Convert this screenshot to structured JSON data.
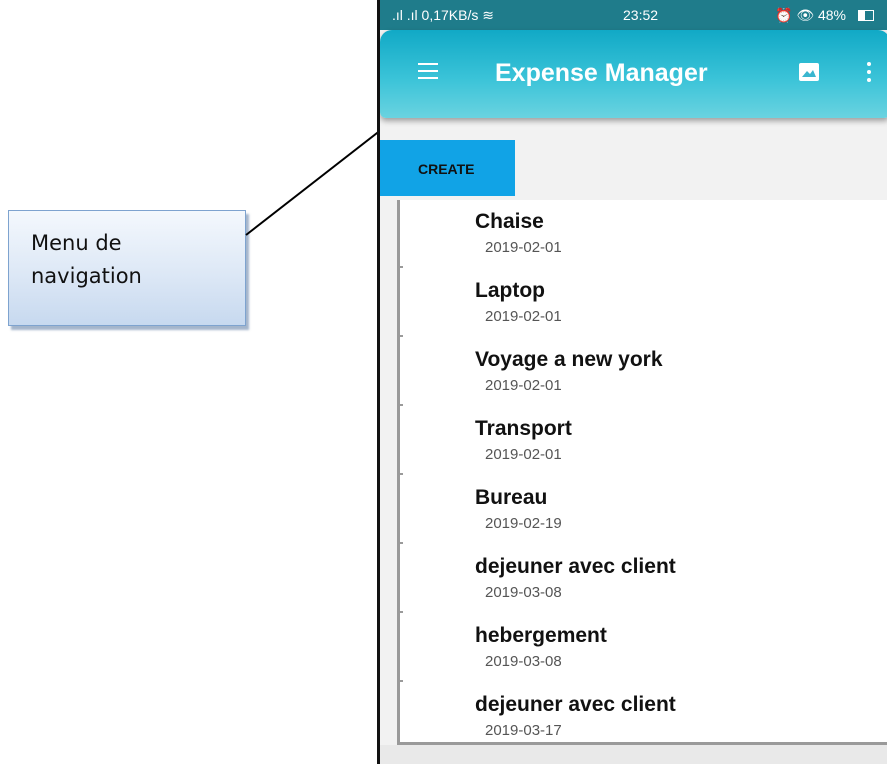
{
  "annotation": {
    "line1": "Menu de",
    "line2": "navigation"
  },
  "status_bar": {
    "left": ".ıl .ıl 0,17KB/s ≋",
    "time": "23:52",
    "right": "⏰ 👁 48%"
  },
  "app_bar": {
    "title": "Expense Manager",
    "menu_icon": "hamburger-menu-icon",
    "image_icon": "image-icon",
    "more_icon": "more-vert-icon"
  },
  "tabs": {
    "create_label": "CREATE"
  },
  "expenses": [
    {
      "name": "Chaise",
      "date": "2019-02-01"
    },
    {
      "name": "Laptop",
      "date": "2019-02-01"
    },
    {
      "name": "Voyage a new york",
      "date": "2019-02-01"
    },
    {
      "name": "Transport",
      "date": "2019-02-01"
    },
    {
      "name": "Bureau",
      "date": "2019-02-19"
    },
    {
      "name": "dejeuner avec client",
      "date": "2019-03-08"
    },
    {
      "name": "hebergement",
      "date": "2019-03-08"
    },
    {
      "name": "dejeuner avec client",
      "date": "2019-03-17"
    }
  ],
  "colors": {
    "accent": "#11a3e6",
    "appbar": "#3ac3d8",
    "statusbar": "#1f7c8b"
  }
}
